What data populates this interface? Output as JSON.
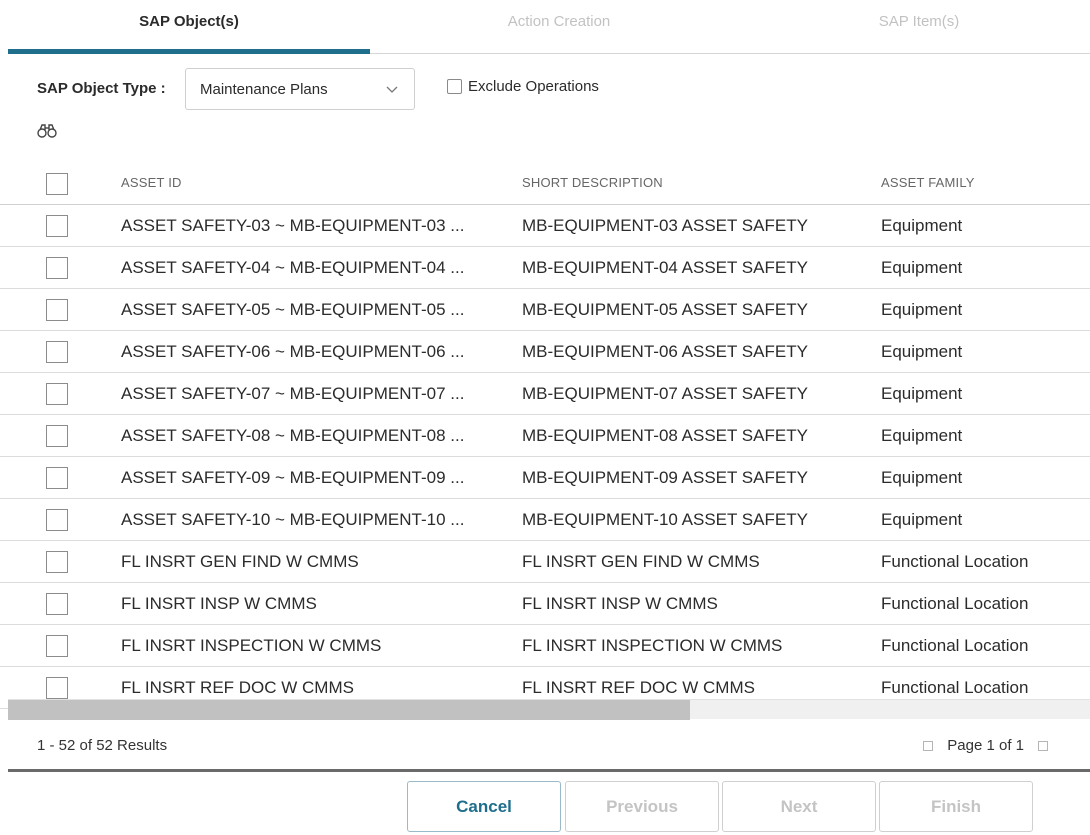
{
  "steps": [
    {
      "label": "SAP Object(s)",
      "active": true
    },
    {
      "label": "Action Creation",
      "active": false
    },
    {
      "label": "SAP Item(s)",
      "active": false
    }
  ],
  "toolbar": {
    "type_label": "SAP Object Type :",
    "type_value": "Maintenance Plans",
    "exclude_label": "Exclude Operations",
    "search_icon": "binoculars-icon"
  },
  "table": {
    "columns": [
      "ASSET ID",
      "SHORT DESCRIPTION",
      "ASSET FAMILY"
    ],
    "rows": [
      {
        "id": "ASSET SAFETY-03 ~ MB-EQUIPMENT-03 ...",
        "desc": "MB-EQUIPMENT-03 ASSET SAFETY",
        "family": "Equipment"
      },
      {
        "id": "ASSET SAFETY-04 ~ MB-EQUIPMENT-04 ...",
        "desc": "MB-EQUIPMENT-04 ASSET SAFETY",
        "family": "Equipment"
      },
      {
        "id": "ASSET SAFETY-05 ~ MB-EQUIPMENT-05 ...",
        "desc": "MB-EQUIPMENT-05 ASSET SAFETY",
        "family": "Equipment"
      },
      {
        "id": "ASSET SAFETY-06 ~ MB-EQUIPMENT-06 ...",
        "desc": "MB-EQUIPMENT-06 ASSET SAFETY",
        "family": "Equipment"
      },
      {
        "id": "ASSET SAFETY-07 ~ MB-EQUIPMENT-07 ...",
        "desc": "MB-EQUIPMENT-07 ASSET SAFETY",
        "family": "Equipment"
      },
      {
        "id": "ASSET SAFETY-08 ~ MB-EQUIPMENT-08 ...",
        "desc": "MB-EQUIPMENT-08 ASSET SAFETY",
        "family": "Equipment"
      },
      {
        "id": "ASSET SAFETY-09 ~ MB-EQUIPMENT-09 ...",
        "desc": "MB-EQUIPMENT-09 ASSET SAFETY",
        "family": "Equipment"
      },
      {
        "id": "ASSET SAFETY-10 ~ MB-EQUIPMENT-10 ...",
        "desc": "MB-EQUIPMENT-10 ASSET SAFETY",
        "family": "Equipment"
      },
      {
        "id": "FL INSRT GEN FIND W CMMS",
        "desc": "FL INSRT GEN FIND W CMMS",
        "family": "Functional Location"
      },
      {
        "id": "FL INSRT INSP W CMMS",
        "desc": "FL INSRT INSP W CMMS",
        "family": "Functional Location"
      },
      {
        "id": "FL INSRT INSPECTION W CMMS",
        "desc": "FL INSRT INSPECTION W CMMS",
        "family": "Functional Location"
      },
      {
        "id": "FL INSRT REF DOC W CMMS",
        "desc": "FL INSRT REF DOC W CMMS",
        "family": "Functional Location"
      }
    ]
  },
  "pager": {
    "results": "1 - 52 of 52 Results",
    "page": "Page 1 of 1"
  },
  "buttons": {
    "cancel": "Cancel",
    "previous": "Previous",
    "next": "Next",
    "finish": "Finish"
  },
  "colors": {
    "accent": "#1e6e8c",
    "disabled_text": "#c4c4c4"
  }
}
